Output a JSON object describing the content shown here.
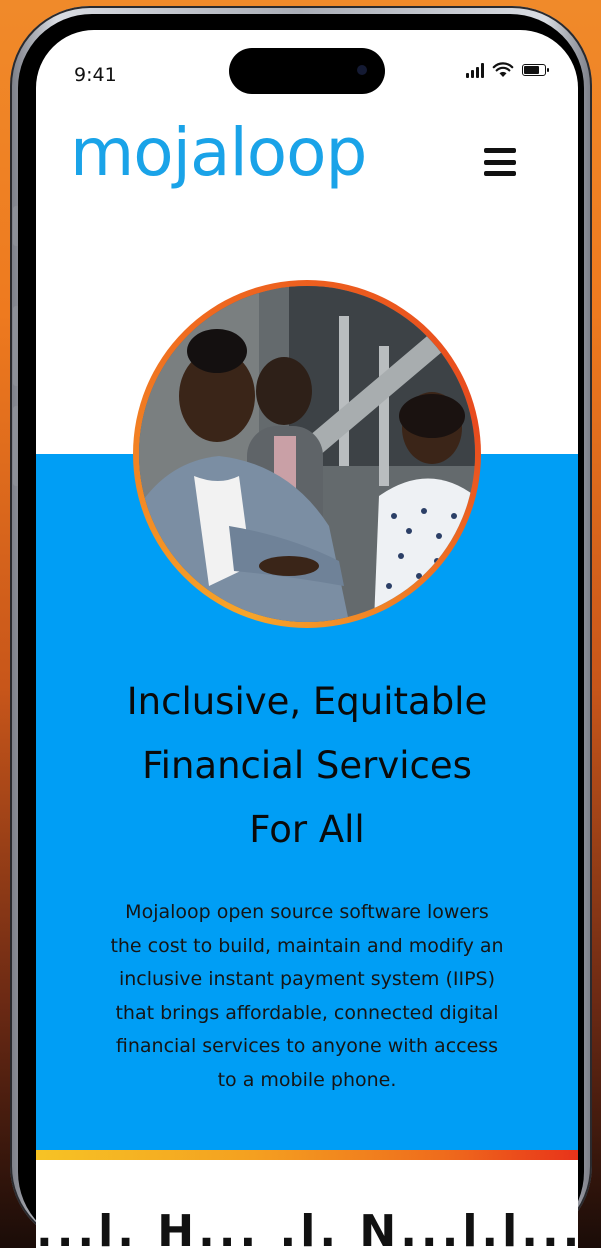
{
  "status_bar": {
    "time": "9:41",
    "signal_icon": "cellular-signal-icon",
    "wifi_icon": "wifi-icon",
    "battery_icon": "battery-icon",
    "battery_level": 0.85
  },
  "header": {
    "logo_text": "mojaloop",
    "logo_color": "#1aa3e8",
    "menu_icon": "hamburger-menu-icon"
  },
  "hero": {
    "background_color": "#009ef5",
    "image_alt": "three smiling people",
    "headline_lines": [
      "Inclusive, Equitable",
      "Financial Services",
      "For All"
    ],
    "description_lines": [
      "Mojaloop open source software lowers",
      "the cost to build, maintain and modify an",
      "inclusive instant payment system (IIPS)",
      "that brings affordable, connected digital",
      "financial services to anyone with access",
      "to a mobile phone."
    ]
  },
  "next_section": {
    "heading_partial": "...l. H... .l. N...l.l..."
  }
}
